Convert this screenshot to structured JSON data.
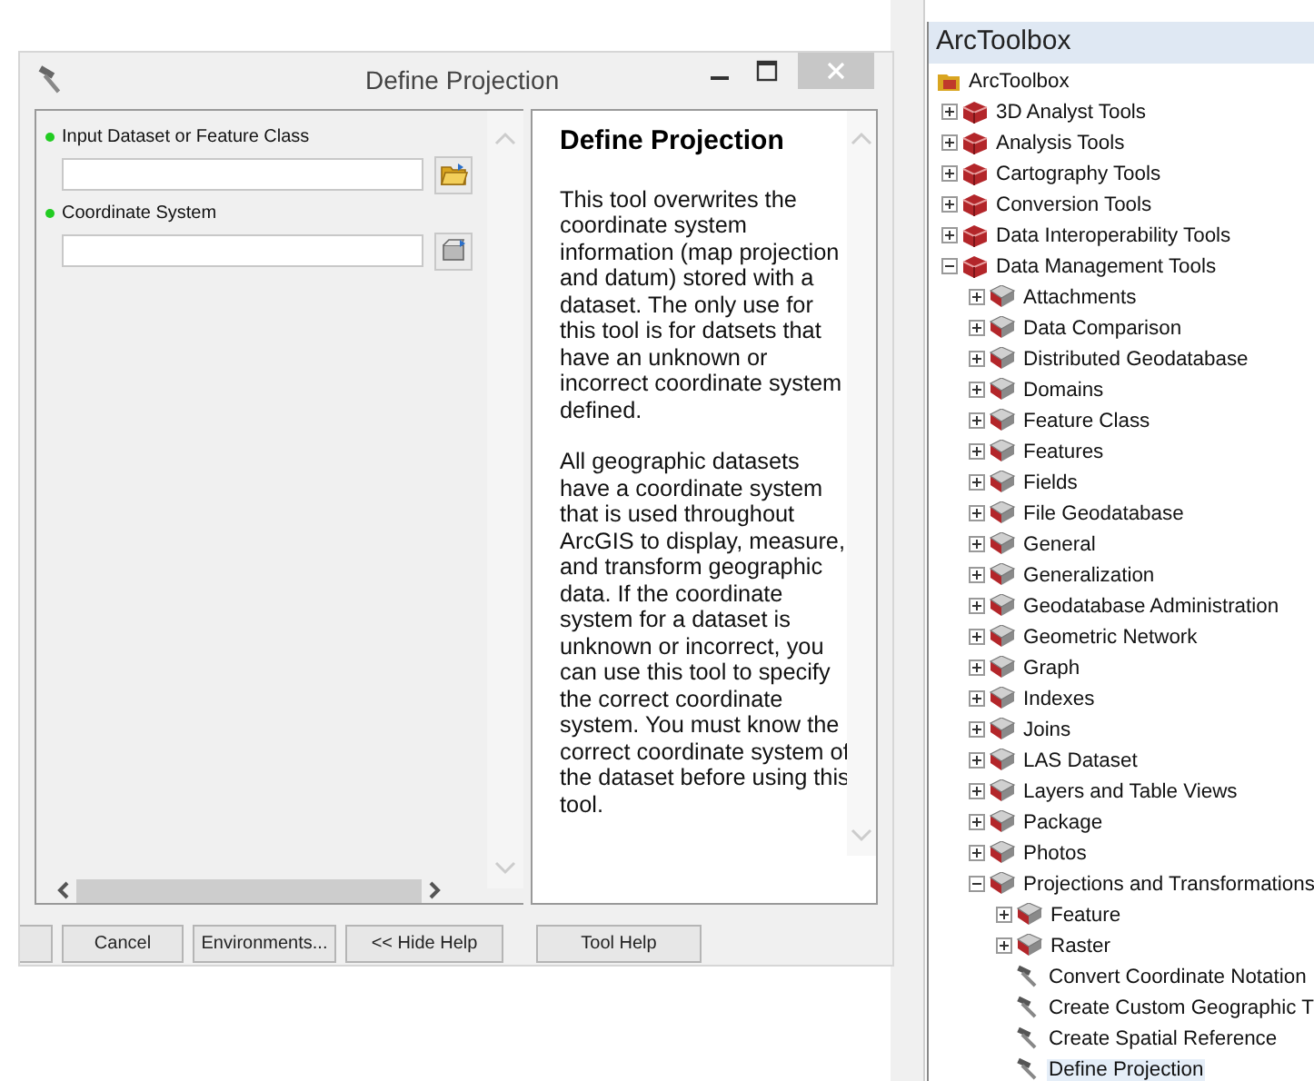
{
  "window": {
    "title": "Define Projection"
  },
  "parameters": [
    {
      "label": "Input Dataset or Feature Class",
      "required": true,
      "kind": "dataset"
    },
    {
      "label": "Coordinate System",
      "required": true,
      "kind": "spatial_reference"
    }
  ],
  "help": {
    "title": "Define Projection",
    "paragraphs": [
      "This tool overwrites the coordinate system information (map projection and datum) stored with a dataset. The only use for this tool is for datsets that have an unknown or incorrect coordinate system defined.",
      "All geographic datasets have a coordinate system that is used throughout ArcGIS to display, measure, and transform geographic data. If the coordinate system for a dataset is unknown or incorrect, you can use this tool to specify the correct coordinate system. You must know the correct coordinate system of the dataset before using this tool."
    ]
  },
  "buttons": [
    "Cancel",
    "Environments...",
    "<< Hide Help",
    "Tool Help"
  ],
  "toolbox": {
    "title": "ArcToolbox",
    "tree": [
      {
        "label": "ArcToolbox",
        "kind": "root",
        "selected": false,
        "children": [
          {
            "label": "3D Analyst Tools",
            "kind": "toolbox",
            "selected": false,
            "expanded": false
          },
          {
            "label": "Analysis Tools",
            "kind": "toolbox",
            "selected": false,
            "expanded": false
          },
          {
            "label": "Cartography Tools",
            "kind": "toolbox",
            "selected": false,
            "expanded": false
          },
          {
            "label": "Conversion Tools",
            "kind": "toolbox",
            "selected": false,
            "expanded": false
          },
          {
            "label": "Data Interoperability Tools",
            "kind": "toolbox",
            "selected": false,
            "expanded": false
          },
          {
            "label": "Data Management Tools",
            "kind": "toolbox",
            "selected": false,
            "expanded": true,
            "children": [
              {
                "label": "Attachments",
                "kind": "toolset",
                "selected": false,
                "expanded": false
              },
              {
                "label": "Data Comparison",
                "kind": "toolset",
                "selected": false,
                "expanded": false
              },
              {
                "label": "Distributed Geodatabase",
                "kind": "toolset",
                "selected": false,
                "expanded": false
              },
              {
                "label": "Domains",
                "kind": "toolset",
                "selected": false,
                "expanded": false
              },
              {
                "label": "Feature Class",
                "kind": "toolset",
                "selected": false,
                "expanded": false
              },
              {
                "label": "Features",
                "kind": "toolset",
                "selected": false,
                "expanded": false
              },
              {
                "label": "Fields",
                "kind": "toolset",
                "selected": false,
                "expanded": false
              },
              {
                "label": "File Geodatabase",
                "kind": "toolset",
                "selected": false,
                "expanded": false
              },
              {
                "label": "General",
                "kind": "toolset",
                "selected": false,
                "expanded": false
              },
              {
                "label": "Generalization",
                "kind": "toolset",
                "selected": false,
                "expanded": false
              },
              {
                "label": "Geodatabase Administration",
                "kind": "toolset",
                "selected": false,
                "expanded": false
              },
              {
                "label": "Geometric Network",
                "kind": "toolset",
                "selected": false,
                "expanded": false
              },
              {
                "label": "Graph",
                "kind": "toolset",
                "selected": false,
                "expanded": false
              },
              {
                "label": "Indexes",
                "kind": "toolset",
                "selected": false,
                "expanded": false
              },
              {
                "label": "Joins",
                "kind": "toolset",
                "selected": false,
                "expanded": false
              },
              {
                "label": "LAS Dataset",
                "kind": "toolset",
                "selected": false,
                "expanded": false
              },
              {
                "label": "Layers and Table Views",
                "kind": "toolset",
                "selected": false,
                "expanded": false
              },
              {
                "label": "Package",
                "kind": "toolset",
                "selected": false,
                "expanded": false
              },
              {
                "label": "Photos",
                "kind": "toolset",
                "selected": false,
                "expanded": false
              },
              {
                "label": "Projections and Transformations",
                "kind": "toolset",
                "selected": false,
                "expanded": true,
                "children": [
                  {
                    "label": "Feature",
                    "kind": "toolset",
                    "selected": false,
                    "expanded": false
                  },
                  {
                    "label": "Raster",
                    "kind": "toolset",
                    "selected": false,
                    "expanded": false
                  },
                  {
                    "label": "Convert Coordinate Notation",
                    "kind": "tool",
                    "selected": false
                  },
                  {
                    "label": "Create Custom Geographic T",
                    "kind": "tool",
                    "selected": false
                  },
                  {
                    "label": "Create Spatial Reference",
                    "kind": "tool",
                    "selected": false
                  },
                  {
                    "label": "Define Projection",
                    "kind": "tool",
                    "selected": true
                  }
                ]
              }
            ]
          }
        ]
      }
    ]
  }
}
